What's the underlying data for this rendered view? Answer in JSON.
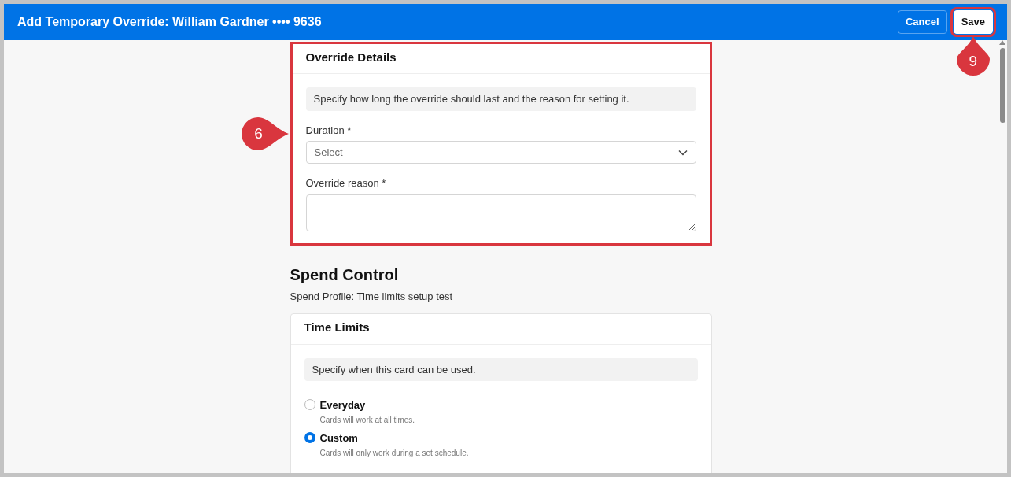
{
  "window": {
    "title": "Add Temporary Override: William Gardner •••• 9636"
  },
  "header_buttons": [
    {
      "label": "Cancel",
      "kind": "outline",
      "highlighted": false
    },
    {
      "label": "Save",
      "kind": "solid",
      "highlighted": true,
      "callout": "9"
    }
  ],
  "override_details": {
    "title": "Override Details",
    "highlighted": true,
    "callout": "6",
    "hint": "Specify how long the override should last and the reason for setting it.",
    "fields": [
      {
        "kind": "select",
        "label": "Duration *",
        "placeholder": "Select"
      },
      {
        "kind": "textarea",
        "label": "Override reason *"
      }
    ]
  },
  "spend_control": {
    "title": "Spend Control",
    "profile": "Spend Profile: Time limits setup test",
    "time_limits": {
      "title": "Time Limits",
      "hint": "Specify when this card can be used.",
      "options": [
        {
          "label": "Everyday",
          "description": "Cards will work at all times.",
          "selected": false
        },
        {
          "label": "Custom",
          "description": "Cards will only work during a set schedule.",
          "selected": true
        }
      ]
    }
  }
}
